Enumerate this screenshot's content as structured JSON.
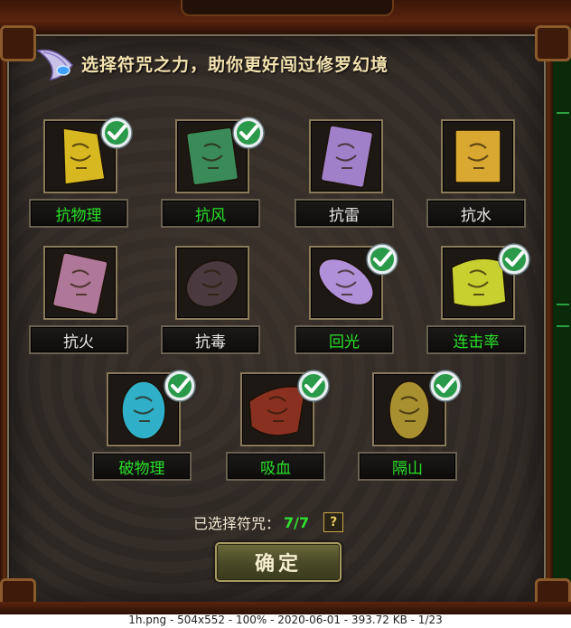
{
  "header": {
    "title": "选择符咒之力，助你更好闯过修罗幻境"
  },
  "charms": [
    {
      "label": "抗物理",
      "selected": true,
      "icon": "gold-talisman-icon",
      "color": "#d8b820"
    },
    {
      "label": "抗风",
      "selected": true,
      "icon": "green-talisman-icon",
      "color": "#3a8a5a"
    },
    {
      "label": "抗雷",
      "selected": false,
      "icon": "purple-talisman-icon",
      "color": "#a080c8"
    },
    {
      "label": "抗水",
      "selected": false,
      "icon": "yellow-talisman-icon",
      "color": "#d8a830"
    },
    {
      "label": "抗火",
      "selected": false,
      "icon": "pink-talisman-icon",
      "color": "#b07898"
    },
    {
      "label": "抗毒",
      "selected": false,
      "icon": "dark-stone-icon",
      "color": "#4a3a40"
    },
    {
      "label": "回光",
      "selected": true,
      "icon": "violet-stone-icon",
      "color": "#b090d8"
    },
    {
      "label": "连击率",
      "selected": true,
      "icon": "scroll-talisman-icon",
      "color": "#c8d030"
    },
    {
      "label": "破物理",
      "selected": true,
      "icon": "cyan-crystal-icon",
      "color": "#30b0c8"
    },
    {
      "label": "吸血",
      "selected": true,
      "icon": "blood-stone-icon",
      "color": "#8a3020"
    },
    {
      "label": "隔山",
      "selected": true,
      "icon": "golden-egg-icon",
      "color": "#a89030"
    }
  ],
  "summary": {
    "label": "已选择符咒：",
    "count": "7/7",
    "help": "?"
  },
  "confirm_label": "确定",
  "statusbar_text": "1h.png - 504x552 - 100% - 2020-06-01 - 393.72 KB - 1/23"
}
